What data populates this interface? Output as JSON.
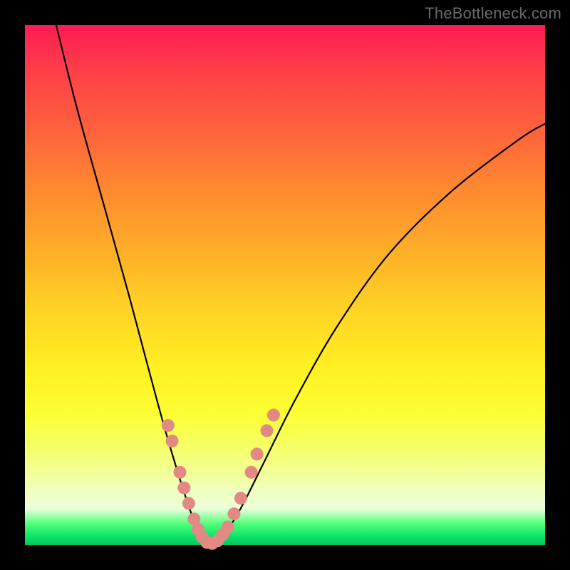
{
  "watermark": "TheBottleneck.com",
  "colors": {
    "curve_stroke": "#000000",
    "marker_fill": "#e38984",
    "frame_bg": "#000000"
  },
  "chart_data": {
    "type": "line",
    "title": "",
    "xlabel": "",
    "ylabel": "",
    "xlim": [
      0,
      100
    ],
    "ylim": [
      0,
      100
    ],
    "series": [
      {
        "name": "bottleneck-curve",
        "x": [
          6,
          10,
          15,
          20,
          24,
          27,
          30,
          32,
          33,
          34,
          35,
          36,
          37,
          39,
          42,
          46,
          52,
          60,
          70,
          82,
          95,
          100
        ],
        "values": [
          100,
          84,
          66,
          48,
          33,
          22,
          12,
          6,
          3,
          1,
          0,
          0,
          1,
          3,
          8,
          16,
          28,
          42,
          56,
          68,
          78,
          81
        ]
      }
    ],
    "markers": [
      {
        "x": 27.5,
        "y": 23
      },
      {
        "x": 28.3,
        "y": 20
      },
      {
        "x": 29.8,
        "y": 14
      },
      {
        "x": 30.6,
        "y": 11
      },
      {
        "x": 31.5,
        "y": 8
      },
      {
        "x": 32.5,
        "y": 5
      },
      {
        "x": 33.3,
        "y": 3
      },
      {
        "x": 34.1,
        "y": 1.5
      },
      {
        "x": 35.0,
        "y": 0.5
      },
      {
        "x": 36.0,
        "y": 0.3
      },
      {
        "x": 37.0,
        "y": 0.8
      },
      {
        "x": 38.0,
        "y": 2
      },
      {
        "x": 39.0,
        "y": 3.5
      },
      {
        "x": 40.2,
        "y": 6
      },
      {
        "x": 41.5,
        "y": 9
      },
      {
        "x": 43.5,
        "y": 14
      },
      {
        "x": 44.6,
        "y": 17.5
      },
      {
        "x": 46.5,
        "y": 22
      },
      {
        "x": 47.8,
        "y": 25
      }
    ]
  }
}
